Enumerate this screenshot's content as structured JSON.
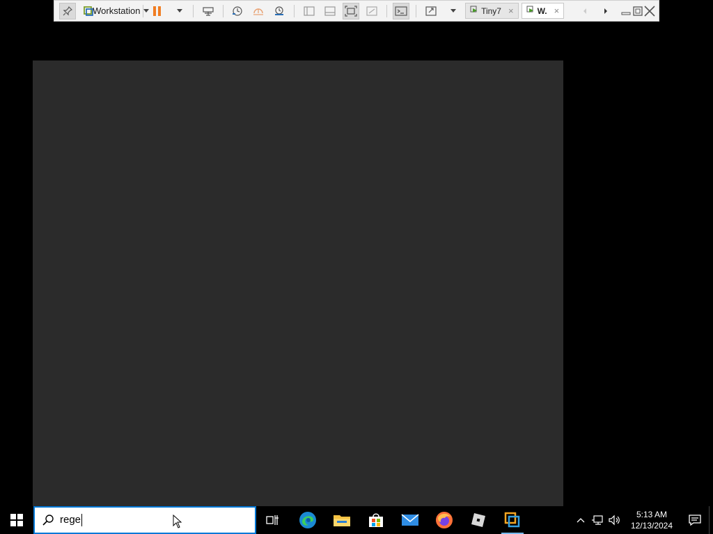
{
  "toolbar": {
    "product_label": "Workstation",
    "tabs": [
      {
        "label": "Tiny7",
        "close": "×"
      },
      {
        "label": "W.",
        "close": "×"
      }
    ]
  },
  "search": {
    "value": "rege"
  },
  "clock": {
    "time": "5:13 AM",
    "date": "12/13/2024"
  },
  "colors": {
    "accent": "#0078d7",
    "pause": "#f07d22",
    "vm_screen": "#2b2b2b",
    "taskbar": "#000000"
  }
}
